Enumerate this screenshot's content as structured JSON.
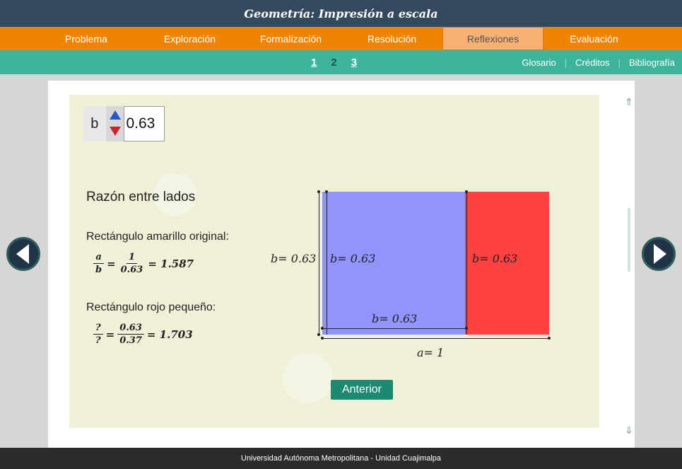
{
  "app": {
    "title": "Geometría: Impresión a escala"
  },
  "main_nav": {
    "tabs": [
      {
        "label": "Problema"
      },
      {
        "label": "Exploración"
      },
      {
        "label": "Formalización"
      },
      {
        "label": "Resolución"
      },
      {
        "label": "Reflexiones",
        "active": true
      },
      {
        "label": "Evaluación"
      }
    ]
  },
  "sub_nav": {
    "pages": [
      "1",
      "2",
      "3"
    ],
    "current_page": "2",
    "links": [
      "Glosario",
      "Créditos",
      "Bibliografía"
    ]
  },
  "stepper": {
    "label": "b",
    "value": "0.63"
  },
  "content": {
    "heading": "Razón entre lados",
    "original_label": "Rectángulo amarillo original:",
    "original_formula": {
      "num": "a",
      "den": "b",
      "num2": "1",
      "den2": "0.63",
      "result": "= 1.587"
    },
    "small_label": "Rectángulo rojo pequeño:",
    "small_formula": {
      "num": "?",
      "den": "?",
      "num2": "0.63",
      "den2": "0.37",
      "result": "= 1.703"
    }
  },
  "diagram": {
    "colors": {
      "square": "#9294fe",
      "rect": "#fe4141"
    },
    "label_left": "b=  0.63",
    "label_inner_left": "b=  0.63",
    "label_red": "b=  0.63",
    "label_bottom_inner": "b=  0.63",
    "label_a": "a=  1"
  },
  "buttons": {
    "prev_label": "Anterior"
  },
  "footer": {
    "text": "Universidad Autónoma Metropolitana - Unidad Cuajimalpa"
  },
  "icons": {
    "prev": "chevron-left-icon",
    "next": "chevron-right-icon"
  }
}
